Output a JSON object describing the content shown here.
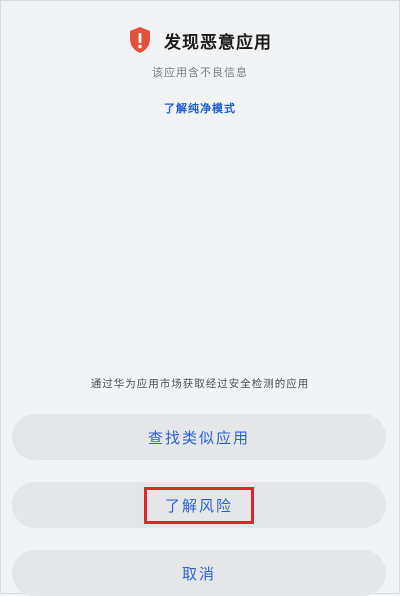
{
  "header": {
    "title": "发现恶意应用",
    "subtitle": "该应用含不良信息"
  },
  "learn_link": "了解纯净模式",
  "notice": "通过华为应用市场获取经过安全检测的应用",
  "buttons": {
    "find_similar": "查找类似应用",
    "learn_risk": "了解风险",
    "cancel": "取消"
  },
  "colors": {
    "accent": "#2d63d4",
    "shield": "#e2523d",
    "highlight": "#e3242b"
  }
}
